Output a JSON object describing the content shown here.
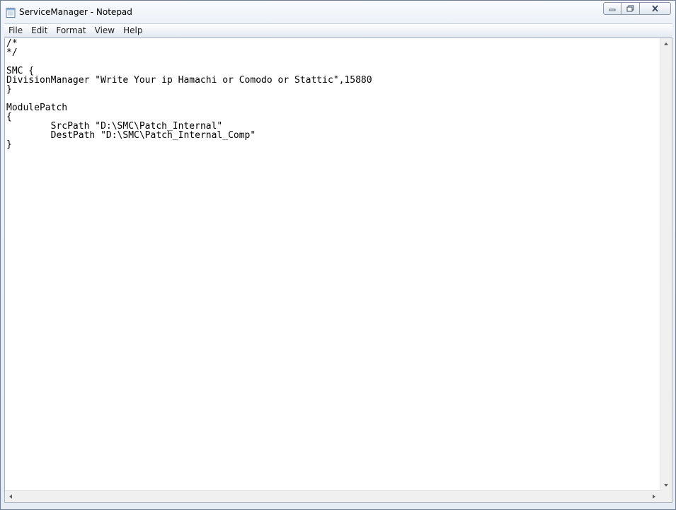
{
  "window": {
    "title": "ServiceManager - Notepad",
    "icon": "notepad-icon"
  },
  "menu": {
    "items": [
      {
        "label": "File"
      },
      {
        "label": "Edit"
      },
      {
        "label": "Format"
      },
      {
        "label": "View"
      },
      {
        "label": "Help"
      }
    ]
  },
  "editor": {
    "content": "/*\n*/\n\nSMC {\nDivisionManager \"Write Your ip Hamachi or Comodo or Stattic\",15880\n}\n\nModulePatch\n{\n\tSrcPath \"D:\\SMC\\Patch_Internal\"\n\tDestPath \"D:\\SMC\\Patch_Internal_Comp\"\n}"
  },
  "icons": {
    "minimize": "minimize-icon",
    "maximize": "restore-icon",
    "close": "close-icon"
  }
}
